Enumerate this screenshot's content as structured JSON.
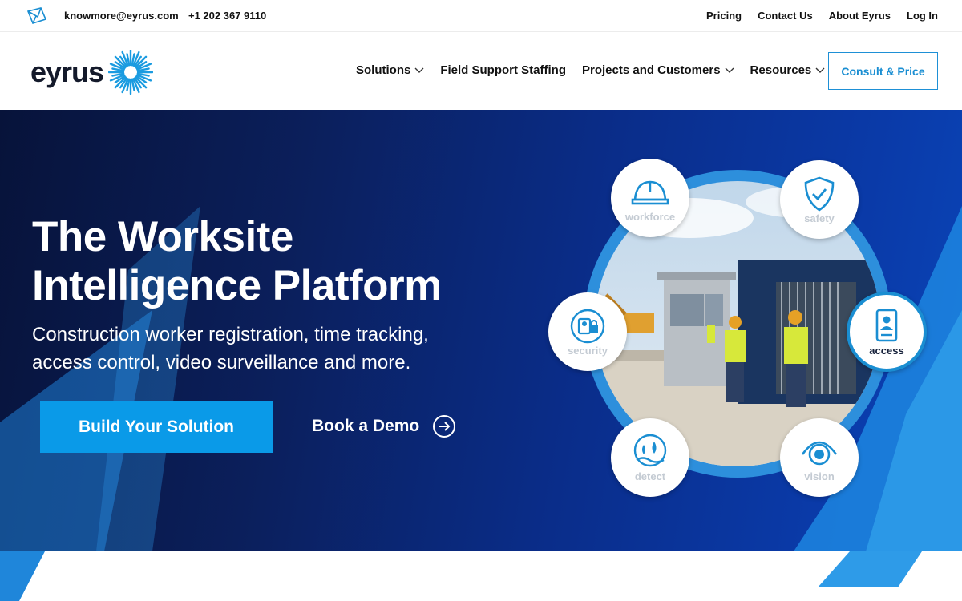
{
  "topbar": {
    "email": "knowmore@eyrus.com",
    "phone": "+1 202 367 9110",
    "links": [
      "Pricing",
      "Contact Us",
      "About Eyrus",
      "Log In"
    ]
  },
  "header": {
    "logo_text": "eyrus",
    "nav": [
      {
        "label": "Solutions",
        "has_dropdown": true
      },
      {
        "label": "Field Support Staffing",
        "has_dropdown": false
      },
      {
        "label": "Projects and Customers",
        "has_dropdown": true
      },
      {
        "label": "Resources",
        "has_dropdown": true
      }
    ],
    "cta_label": "Consult & Price"
  },
  "hero": {
    "title": "The Worksite Intelligence Platform",
    "subtitle": "Construction worker registration, time tracking, access control, video surveillance and more.",
    "primary_button": "Build Your Solution",
    "secondary_link": "Book a Demo",
    "badges": [
      {
        "label": "workforce",
        "icon": "hardhat-icon",
        "active": false
      },
      {
        "label": "safety",
        "icon": "shield-check-icon",
        "active": false
      },
      {
        "label": "security",
        "icon": "security-badge-icon",
        "active": false
      },
      {
        "label": "access",
        "icon": "id-card-icon",
        "active": true
      },
      {
        "label": "detect",
        "icon": "detect-icon",
        "active": false
      },
      {
        "label": "vision",
        "icon": "camera-eye-icon",
        "active": false
      }
    ]
  },
  "colors": {
    "accent": "#0a9ae8",
    "brand_dark": "#141a2b",
    "hero_dark": "#07133a",
    "hero_blue": "#0a45b8",
    "ring_blue": "#1a8ed2"
  }
}
